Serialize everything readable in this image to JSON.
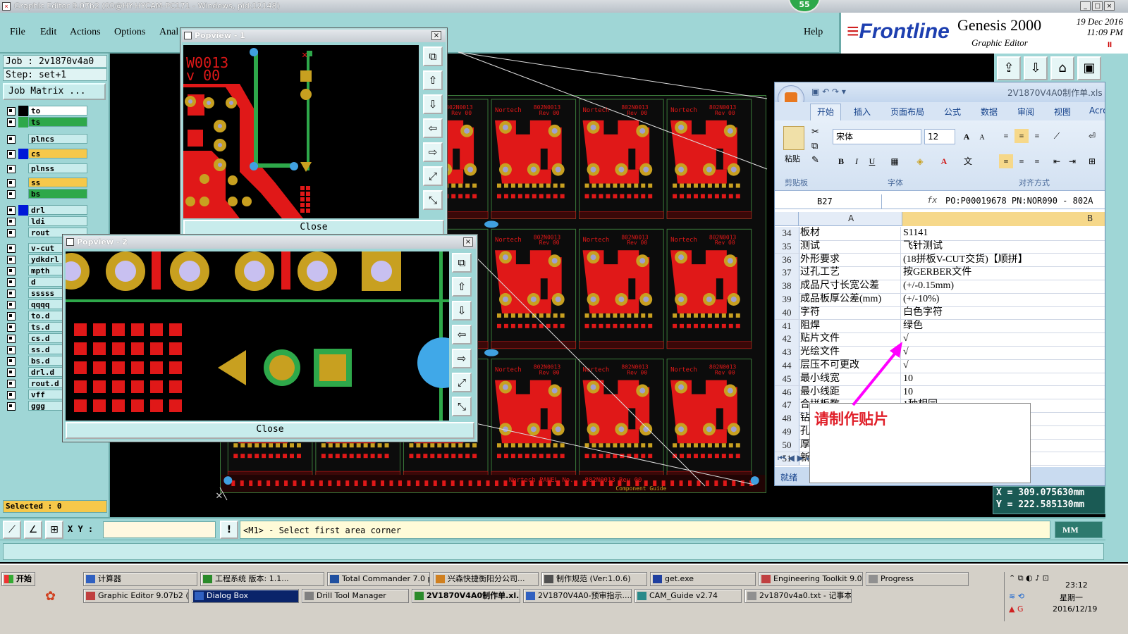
{
  "window": {
    "title": "Graphic Editor 9.07b2 (00@HY-HYCAM-PC171 - Windows, pid:12148)",
    "controls": [
      "_",
      "□",
      "×"
    ],
    "badge": "55"
  },
  "menu": {
    "items": [
      "File",
      "Edit",
      "Actions",
      "Options",
      "Anal"
    ],
    "help": "Help"
  },
  "branding": {
    "logo": "Frontline",
    "product": "Genesis 2000",
    "subtitle": "Graphic Editor",
    "date": "19 Dec 2016",
    "time": "11:09 PM",
    "pause": "II"
  },
  "left_panel": {
    "job": "Job : 2v1870v4a0",
    "step": "Step: set+1",
    "job_matrix": "Job Matrix ...",
    "layers": [
      {
        "name": "to",
        "swatch": "#000000",
        "bg": "#ffffff"
      },
      {
        "name": "ts",
        "swatch": "#2ea84a",
        "bg": "#2ea84a"
      },
      {
        "name": "plncs",
        "swatch": "",
        "bg": "#c8ecec"
      },
      {
        "name": "cs",
        "swatch": "#0018d8",
        "bg": "#f6c84a"
      },
      {
        "name": "plnss",
        "swatch": "",
        "bg": "#c8ecec"
      },
      {
        "name": "ss",
        "swatch": "",
        "bg": "#f6c84a"
      },
      {
        "name": "bs",
        "swatch": "",
        "bg": "#2ea84a"
      },
      {
        "name": "drl",
        "swatch": "#0018d8",
        "bg": "#c8ecec"
      },
      {
        "name": "ldi",
        "swatch": "",
        "bg": "#c8ecec"
      },
      {
        "name": "rout",
        "swatch": "",
        "bg": "#c8ecec"
      },
      {
        "name": "v-cut",
        "swatch": "",
        "bg": "#c8ecec"
      },
      {
        "name": "ydkdrl",
        "swatch": "",
        "bg": "#c8ecec"
      },
      {
        "name": "mpth",
        "swatch": "",
        "bg": "#c8ecec"
      },
      {
        "name": "d",
        "swatch": "",
        "bg": "#c8ecec"
      },
      {
        "name": "sssss",
        "swatch": "",
        "bg": "#c8ecec"
      },
      {
        "name": "qqqq",
        "swatch": "",
        "bg": "#c8ecec"
      },
      {
        "name": "to.d",
        "swatch": "",
        "bg": "#c8ecec"
      },
      {
        "name": "ts.d",
        "swatch": "",
        "bg": "#c8ecec"
      },
      {
        "name": "cs.d",
        "swatch": "",
        "bg": "#c8ecec"
      },
      {
        "name": "ss.d",
        "swatch": "",
        "bg": "#c8ecec"
      },
      {
        "name": "bs.d",
        "swatch": "",
        "bg": "#c8ecec"
      },
      {
        "name": "drl.d",
        "swatch": "",
        "bg": "#c8ecec"
      },
      {
        "name": "rout.d",
        "swatch": "",
        "bg": "#c8ecec"
      },
      {
        "name": "vff",
        "swatch": "",
        "bg": "#c8ecec"
      },
      {
        "name": "ggg",
        "swatch": "",
        "bg": "#c8ecec"
      }
    ],
    "selected": "Selected : 0"
  },
  "popview1": {
    "title": "Popview - 1",
    "label_line1": "W0013",
    "label_line2": "v 00",
    "close": "Close"
  },
  "popview2": {
    "title": "Popview - 2",
    "close": "Close"
  },
  "board": {
    "panel_labels": [
      "Nortech",
      "802N0013",
      "Rev 00"
    ],
    "footer": "Nortech PANEL No.",
    "footer2": "802N0013 Rev 00",
    "footer3": "Component Guide"
  },
  "excel": {
    "title": "2V1870V4A0制作单.xls",
    "tabs": [
      "开始",
      "插入",
      "页面布局",
      "公式",
      "数据",
      "审阅",
      "视图",
      "Acro"
    ],
    "clipboard_label": "粘贴",
    "clipboard_group": "剪贴板",
    "font_name": "宋体",
    "font_size": "12",
    "font_group": "字体",
    "align_group": "对齐方式",
    "cell_ref": "B27",
    "fx": "fx",
    "formula": "PO:P00019678 PN:NOR090 - 802A",
    "col_a": "A",
    "col_b": "B",
    "rows": [
      {
        "n": "34",
        "a": "板材",
        "b": "S1141"
      },
      {
        "n": "35",
        "a": "测试",
        "b": "飞针测试"
      },
      {
        "n": "36",
        "a": "外形要求",
        "b": "(18拼板V-CUT交货)【顺拼】"
      },
      {
        "n": "37",
        "a": "过孔工艺",
        "b": "按GERBER文件"
      },
      {
        "n": "38",
        "a": "成品尺寸长宽公差",
        "b": "(+/-0.15mm)"
      },
      {
        "n": "39",
        "a": "成品板厚公差(mm)",
        "b": "(+/-10%)"
      },
      {
        "n": "40",
        "a": "字符",
        "b": "白色字符"
      },
      {
        "n": "41",
        "a": "阻焊",
        "b": "绿色"
      },
      {
        "n": "42",
        "a": "贴片文件",
        "b": "√"
      },
      {
        "n": "43",
        "a": "光绘文件",
        "b": "√"
      },
      {
        "n": "44",
        "a": "层压不可更改",
        "b": "√"
      },
      {
        "n": "45",
        "a": "最小线宽",
        "b": "10"
      },
      {
        "n": "46",
        "a": "最小线距",
        "b": "10"
      },
      {
        "n": "47",
        "a": "合拼板数",
        "b": "1种相同"
      },
      {
        "n": "48",
        "a": "钻",
        "b": ""
      },
      {
        "n": "49",
        "a": "孔",
        "b": ""
      },
      {
        "n": "50",
        "a": "厚",
        "b": ""
      },
      {
        "n": "51",
        "a": "新",
        "b": ""
      }
    ],
    "status": "就绪",
    "note": "请制作贴片"
  },
  "coords": {
    "x": "X = 309.075630mm",
    "y": "Y = 222.585130mm"
  },
  "command": {
    "xy_label": "X Y :",
    "message": "<M1> - Select first area corner",
    "units": "MM",
    "bang": "!"
  },
  "taskbar": {
    "start": "开始",
    "row1": [
      "计算器",
      "工程系统  版本: 1.1...",
      "Total Commander 7.0 p...",
      "兴森快捷衡阳分公司...",
      "制作规范 (Ver:1.0.6)",
      "get.exe",
      "Engineering Toolkit 9.0...",
      "Progress"
    ],
    "row2": [
      "Graphic Editor 9.07b2 (0...",
      "Dialog Box",
      "Drill Tool Manager",
      "2V1870V4A0制作单.xl...",
      "2V1870V4A0-预审指示....",
      "CAM_Guide v2.74",
      "2v1870v4a0.txt - 记事本"
    ],
    "time": "23:12",
    "weekday": "星期一",
    "date": "2016/12/19"
  },
  "colors": {
    "panel": "#9fd6d6",
    "copper": "#e01818",
    "pad": "#c8a020",
    "trace_green": "#2ea84a"
  }
}
